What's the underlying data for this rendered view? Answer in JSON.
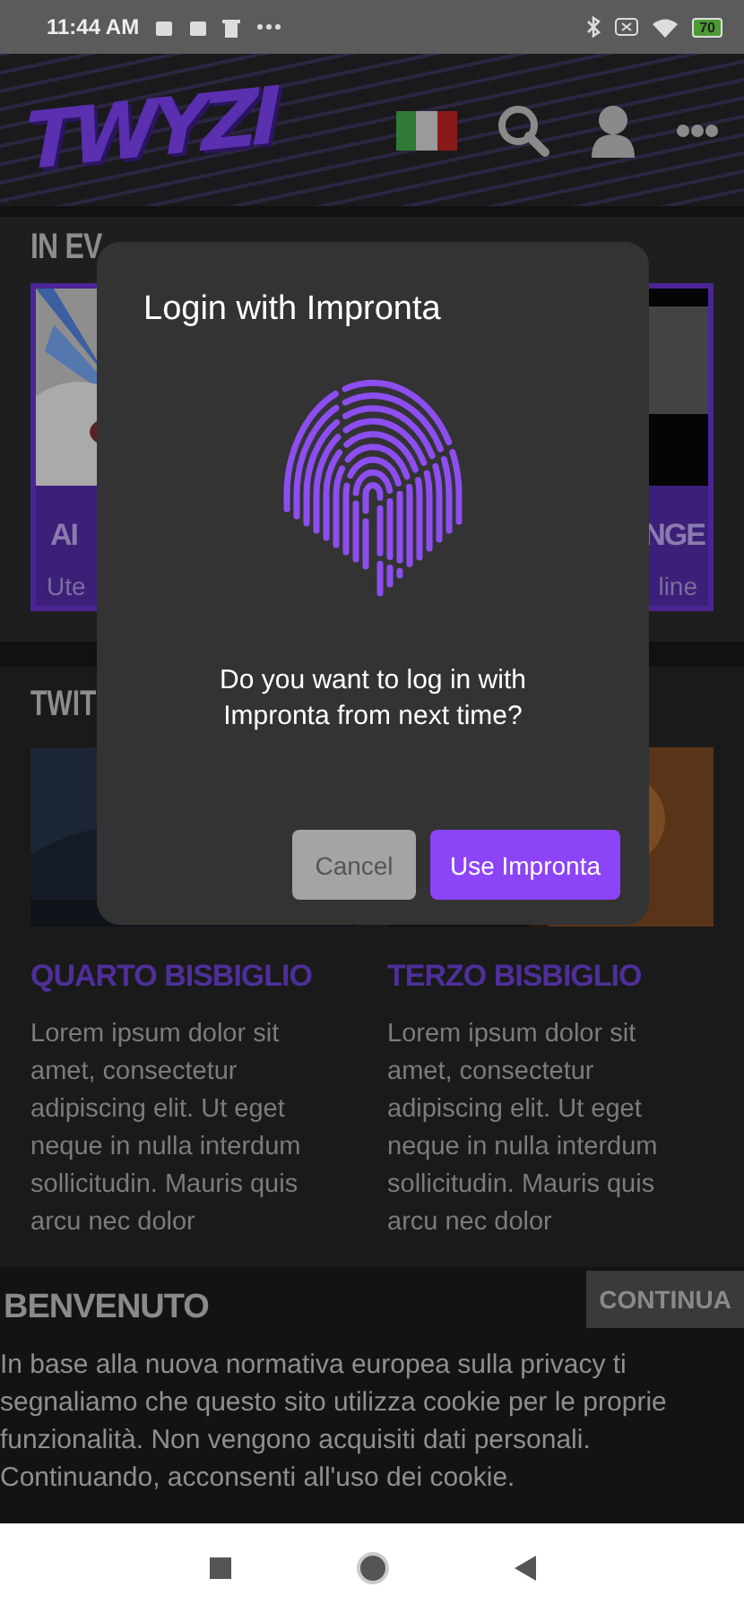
{
  "status_bar": {
    "time": "11:44 AM",
    "battery": "70"
  },
  "header": {
    "logo": "TWYZI"
  },
  "featured": {
    "title": "IN EV",
    "cards": [
      {
        "title": "AI",
        "subtitle": "Ute",
        "kind": "left"
      },
      {
        "title": "NGE",
        "subtitle": "line",
        "kind": "right"
      }
    ]
  },
  "twitch": {
    "title": "TWIT",
    "posts": [
      {
        "title": "QUARTO BISBIGLIO",
        "text": "Lorem ipsum dolor sit amet, consectetur adipiscing elit. Ut eget neque in nulla interdum sollicitudin. Mauris quis arcu nec dolor"
      },
      {
        "title": "TERZO BISBIGLIO",
        "text": "Lorem ipsum dolor sit amet, consectetur adipiscing elit. Ut eget neque in nulla interdum sollicitudin. Mauris quis arcu nec dolor"
      }
    ]
  },
  "welcome": "BENVENUTO",
  "continue_button": "CONTINUA",
  "cookie_notice": "In base alla nuova normativa europea sulla privacy ti segnaliamo che questo sito utilizza cookie per le proprie funzionalità. Non vengono acquisiti dati personali. Continuando, acconsenti all'uso dei cookie.",
  "dialog": {
    "title": "Login with Impronta",
    "message": "Do you want to log in with Impronta from next time?",
    "buttons": [
      {
        "label": "Cancel",
        "kind": "secondary"
      },
      {
        "label": "Use Impronta",
        "kind": "primary"
      }
    ]
  }
}
